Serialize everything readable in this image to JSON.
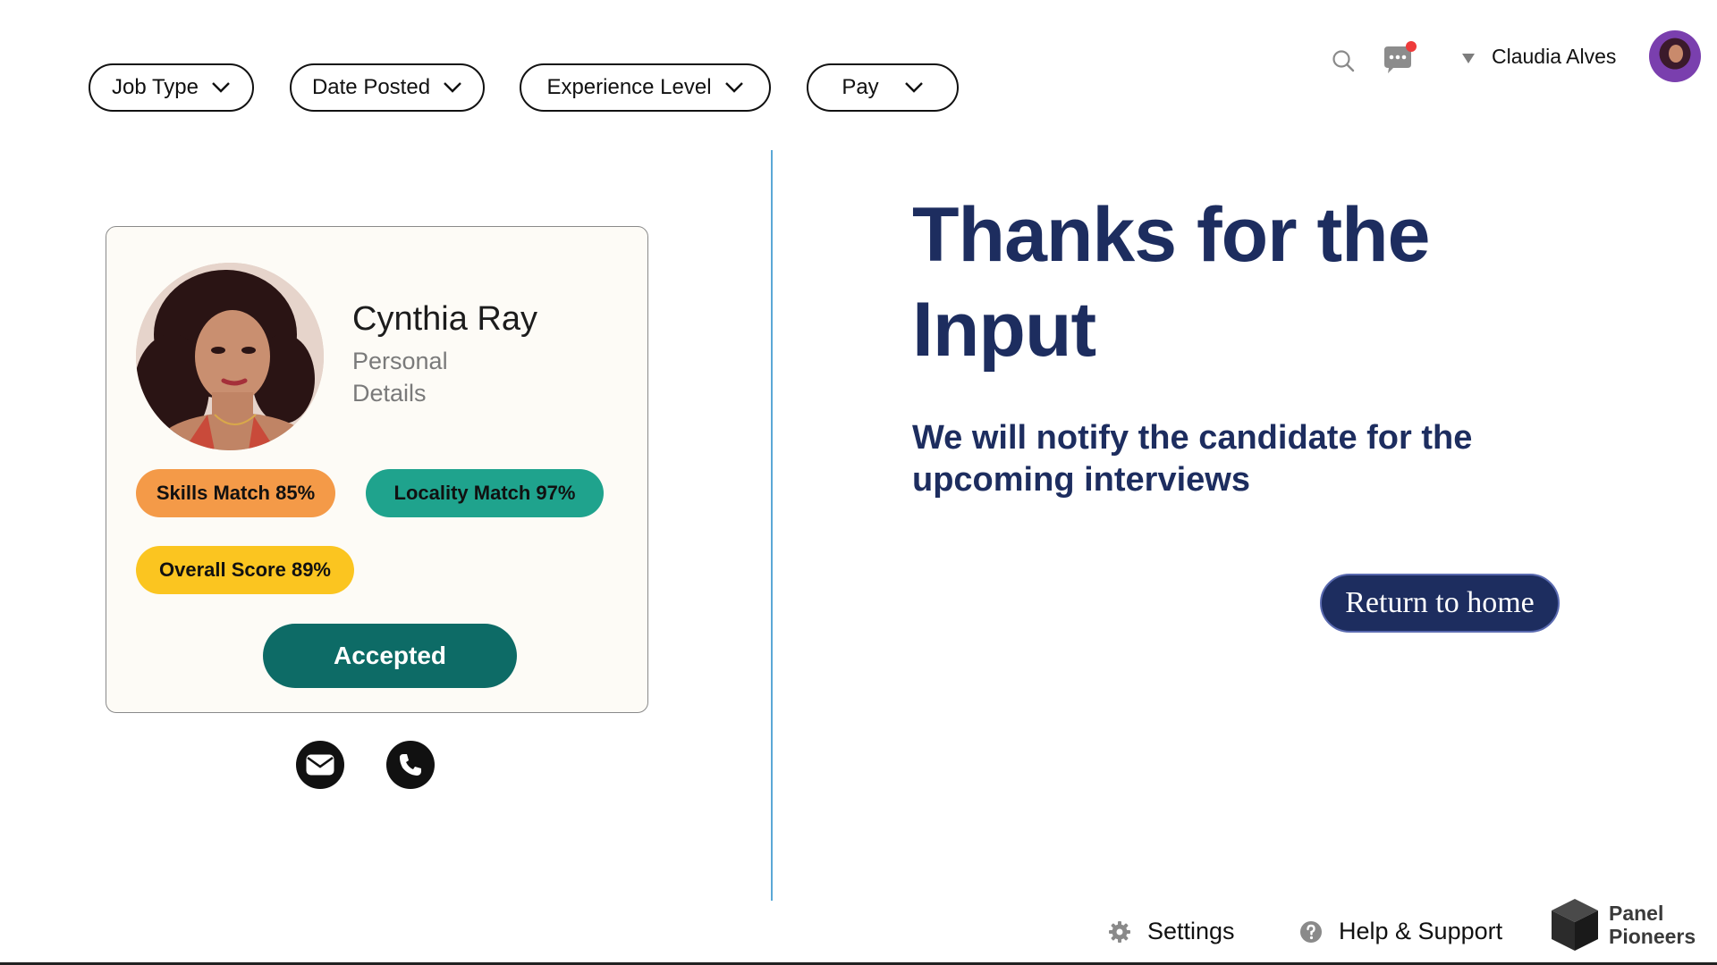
{
  "filters": [
    {
      "label": "Job Type"
    },
    {
      "label": "Date Posted"
    },
    {
      "label": "Experience Level"
    },
    {
      "label": "Pay"
    }
  ],
  "header": {
    "user_name": "Claudia Alves",
    "icons": [
      "search-icon",
      "chat-icon",
      "caret-down-icon",
      "avatar"
    ],
    "notification_dot_color": "#ef3b3b"
  },
  "candidate": {
    "name": "Cynthia Ray",
    "subtitle": "Personal Details",
    "skills_match": "Skills Match 85%",
    "locality_match": "Locality Match 97%",
    "overall_score": "Overall Score 89%",
    "status_button": "Accepted",
    "contact_icons": [
      "email-icon",
      "phone-icon"
    ]
  },
  "confirmation": {
    "title": "Thanks for the Input",
    "message": "We will notify the candidate for the upcoming interviews",
    "return_button": "Return to home"
  },
  "footer": {
    "settings_label": "Settings",
    "help_label": "Help & Support",
    "brand_name": "Panel Pioneers"
  },
  "colors": {
    "navy": "#1d2d5f",
    "teal_button": "#0d6b66",
    "skills": "#f49a48",
    "locality": "#1fa38d",
    "overall": "#fbc520",
    "divider": "#5aa8d6"
  }
}
